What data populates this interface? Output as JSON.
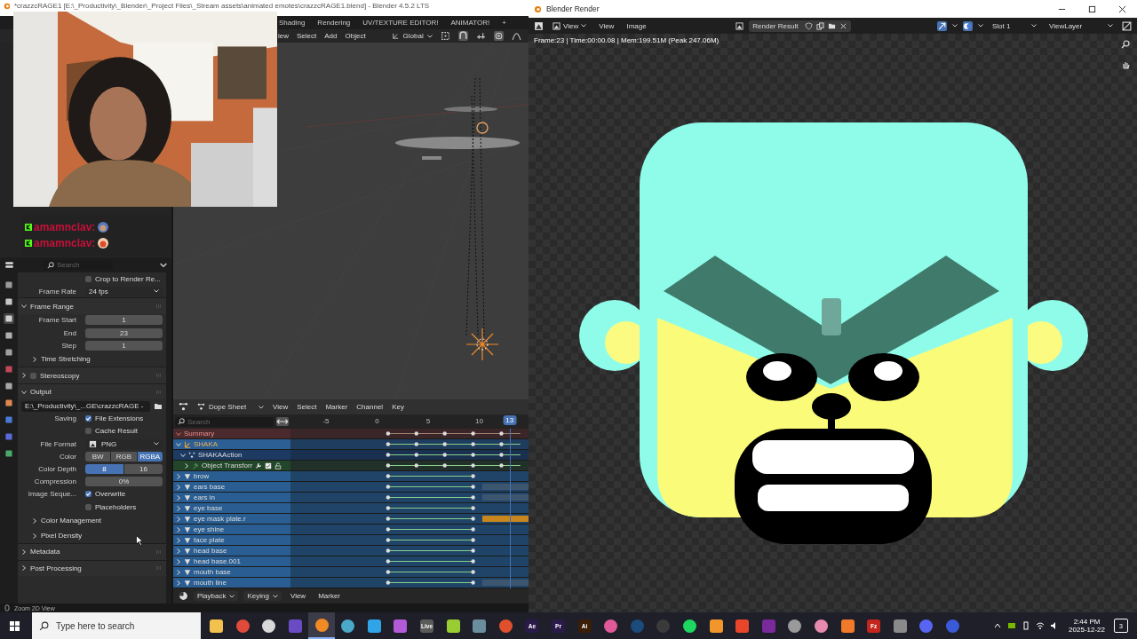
{
  "main_window": {
    "title": "*crazzcRAGE1 [E:\\_Productivity\\_Blender\\_Project Files\\_Stream assets\\animated emotes\\crazzcRAGE1.blend] - Blender 4.5.2 LTS",
    "workspace_tabs": [
      "Shading",
      "Rendering",
      "UV/TEXTURE EDITOR!",
      "ANIMATOR!",
      "+"
    ],
    "viewport_menus": [
      "iew",
      "Select",
      "Add",
      "Object"
    ],
    "orientation": "Global",
    "status_bar": "Zoom 2D View"
  },
  "chat": [
    {
      "user": "amamnclav:"
    },
    {
      "user": "amamnclav:"
    }
  ],
  "properties": {
    "search_placeholder": "Search",
    "rows": [
      {
        "kind": "checkbox",
        "label": "",
        "text": "Crop to Render Re...",
        "checked": false
      },
      {
        "kind": "dropdown",
        "label": "Frame Rate",
        "value": "24 fps"
      },
      {
        "kind": "panel",
        "label": "Frame Range",
        "expanded": true
      },
      {
        "kind": "number",
        "label": "Frame Start",
        "value": "1"
      },
      {
        "kind": "number",
        "label": "End",
        "value": "23"
      },
      {
        "kind": "number",
        "label": "Step",
        "value": "1"
      },
      {
        "kind": "subpanel",
        "label": "Time Stretching",
        "expanded": false
      },
      {
        "kind": "panel",
        "label": "Stereoscopy",
        "expanded": false,
        "checked": false
      },
      {
        "kind": "panel",
        "label": "Output",
        "expanded": true
      },
      {
        "kind": "path",
        "value": "E:\\_Productivity\\_...GE\\crazzcRAGE -"
      },
      {
        "kind": "checkbox",
        "label": "Saving",
        "text": "File Extensions",
        "checked": true
      },
      {
        "kind": "checkbox",
        "label": "",
        "text": "Cache Result",
        "checked": false
      },
      {
        "kind": "dropdown",
        "label": "File Format",
        "value": "PNG"
      },
      {
        "kind": "toggle_group",
        "label": "Color",
        "options": [
          {
            "label": "BW",
            "selected": false
          },
          {
            "label": "RGB",
            "selected": false
          },
          {
            "label": "RGBA",
            "selected": true
          }
        ]
      },
      {
        "kind": "toggle_group",
        "label": "Color Depth",
        "options": [
          {
            "label": "8",
            "selected": true
          },
          {
            "label": "16",
            "selected": false
          }
        ]
      },
      {
        "kind": "slider",
        "label": "Compression",
        "value": "0%",
        "level": 0
      },
      {
        "kind": "checkbox",
        "label": "Image Seque...",
        "text": "Overwrite",
        "checked": true
      },
      {
        "kind": "checkbox",
        "label": "",
        "text": "Placeholders",
        "checked": false
      },
      {
        "kind": "subpanel",
        "label": "Color Management",
        "expanded": false
      },
      {
        "kind": "subpanel",
        "label": "Pixel Density",
        "expanded": false
      },
      {
        "kind": "panel",
        "label": "Metadata",
        "expanded": false
      },
      {
        "kind": "panel",
        "label": "Post Processing",
        "expanded": false
      }
    ]
  },
  "dope_sheet": {
    "mode": "Dope Sheet",
    "menus": [
      "View",
      "Select",
      "Marker",
      "Channel",
      "Key"
    ],
    "search_placeholder": "Search",
    "ticks": [
      "-5",
      "0",
      "5",
      "10"
    ],
    "current_frame": "13",
    "channels": [
      {
        "kind": "summary",
        "name": "Summary",
        "expanded": true
      },
      {
        "kind": "object",
        "name": "SHAKA",
        "expanded": true
      },
      {
        "kind": "action",
        "name": "SHAKAAction",
        "expanded": true
      },
      {
        "kind": "group",
        "name": "Object Transforr",
        "expanded": false
      },
      {
        "kind": "mesh",
        "name": "brow",
        "expanded": false
      },
      {
        "kind": "mesh",
        "name": "ears base",
        "expanded": false,
        "color": "#3d5670"
      },
      {
        "kind": "mesh",
        "name": "ears in",
        "expanded": false,
        "color": "#3d5670"
      },
      {
        "kind": "mesh",
        "name": "eye base",
        "expanded": false
      },
      {
        "kind": "mesh",
        "name": "eye mask plate.r",
        "expanded": false,
        "color": "#c8861e"
      },
      {
        "kind": "mesh",
        "name": "eye shine",
        "expanded": false
      },
      {
        "kind": "mesh",
        "name": "face plate",
        "expanded": false
      },
      {
        "kind": "mesh",
        "name": "head base",
        "expanded": false
      },
      {
        "kind": "mesh",
        "name": "head base.001",
        "expanded": false
      },
      {
        "kind": "mesh",
        "name": "mouth base",
        "expanded": false
      },
      {
        "kind": "mesh",
        "name": "mouth line",
        "expanded": false,
        "color": "#3d5670"
      }
    ],
    "footer_menus": [
      {
        "label": "Playback",
        "dropdown": true
      },
      {
        "label": "Keying",
        "dropdown": true
      },
      {
        "label": "View",
        "dropdown": false
      },
      {
        "label": "Marker",
        "dropdown": false
      }
    ]
  },
  "render_window": {
    "title": "Blender Render",
    "menus": [
      {
        "label": "View",
        "dropdown": true
      },
      {
        "label": "View",
        "dropdown": false
      },
      {
        "label": "Image",
        "dropdown": false
      }
    ],
    "image_name": "Render Result",
    "slot": "Slot 1",
    "view_layer": "ViewLayer",
    "info": "Frame:23 | Time:00:00.08 | Mem:199.51M (Peak 247.06M)"
  },
  "taskbar": {
    "search_placeholder": "Type here to search",
    "apps": [
      {
        "kind": "square",
        "color": "#f2c14e",
        "selected": false
      },
      {
        "kind": "circle",
        "color": "#e04a3a",
        "selected": false
      },
      {
        "kind": "circle",
        "color": "#d8d8d8",
        "selected": false
      },
      {
        "kind": "square",
        "color": "#6a4bc4",
        "selected": false
      },
      {
        "kind": "circle",
        "color": "#f08a24",
        "selected": true
      },
      {
        "kind": "circle",
        "color": "#4aa8c8",
        "selected": false
      },
      {
        "kind": "square",
        "color": "#2fa4e7",
        "selected": false
      },
      {
        "kind": "square",
        "color": "#b35ad8",
        "selected": false
      },
      {
        "kind": "square",
        "color": "#5a5a5a",
        "label": "Live",
        "selected": false
      },
      {
        "kind": "square",
        "color": "#9acd32",
        "selected": false
      },
      {
        "kind": "square",
        "color": "#6b8e9e",
        "selected": false
      },
      {
        "kind": "circle",
        "color": "#e0502c",
        "selected": false
      },
      {
        "kind": "square",
        "color": "#2a1a4a",
        "label": "Ae",
        "selected": false
      },
      {
        "kind": "square",
        "color": "#2a1a4a",
        "label": "Pr",
        "selected": false
      },
      {
        "kind": "square",
        "color": "#3a1e06",
        "label": "Ai",
        "selected": false
      },
      {
        "kind": "circle",
        "color": "#e05a9a",
        "selected": false
      },
      {
        "kind": "circle",
        "color": "#1b4b7a",
        "selected": false
      },
      {
        "kind": "circle",
        "color": "#3a3a3a",
        "selected": false
      },
      {
        "kind": "circle",
        "color": "#1ed760",
        "selected": false
      },
      {
        "kind": "square",
        "color": "#f0962a",
        "selected": false
      },
      {
        "kind": "square",
        "color": "#e8452a",
        "selected": false
      },
      {
        "kind": "square",
        "color": "#7a2a9a",
        "selected": false
      },
      {
        "kind": "circle",
        "color": "#9a9a9a",
        "selected": false
      },
      {
        "kind": "circle",
        "color": "#e88ab0",
        "selected": false
      },
      {
        "kind": "square",
        "color": "#f07a2a",
        "selected": false
      },
      {
        "kind": "square",
        "color": "#c4261d",
        "label": "Fz",
        "selected": false
      },
      {
        "kind": "square",
        "color": "#8a8a8a",
        "selected": false
      },
      {
        "kind": "circle",
        "color": "#5865f2",
        "selected": false
      },
      {
        "kind": "circle",
        "color": "#3a5ad8",
        "selected": false
      }
    ],
    "time": "2:44 PM",
    "date": "2025-12-22",
    "notifications": "3"
  }
}
